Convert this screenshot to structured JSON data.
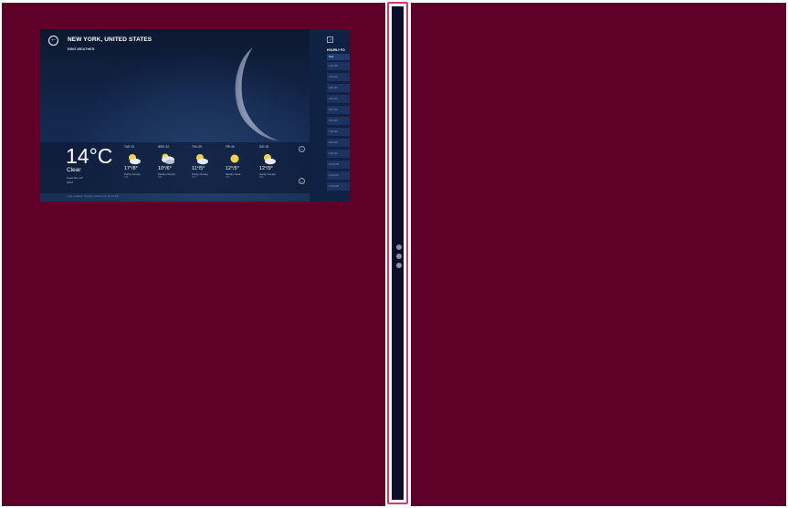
{
  "weather": {
    "back_icon": "back-arrow-icon",
    "location": "NEW YORK, UNITED STATES",
    "app_name": "BING WEATHER",
    "current": {
      "temp": "14°C",
      "condition": "Clear",
      "detail1": "Feels like 14°",
      "detail2": "MIST"
    },
    "forecast": [
      {
        "day": "TUE 23",
        "temp": "17°/8°",
        "cond": "Partly Cloudy",
        "precip": "0 %",
        "icon": "partly-cloudy-icon"
      },
      {
        "day": "WED 24",
        "temp": "10°/6°",
        "cond": "Mostly Cloudy",
        "precip": "0 %",
        "icon": "mostly-cloudy-icon"
      },
      {
        "day": "THU 25",
        "temp": "11°/5°",
        "cond": "Partly Cloudy",
        "precip": "0 %",
        "icon": "partly-cloudy-icon"
      },
      {
        "day": "FRI 26",
        "temp": "12°/5°",
        "cond": "Mostly Clear",
        "precip": "0 %",
        "icon": "sunny-icon"
      },
      {
        "day": "SAT 26",
        "temp": "12°/9°",
        "cond": "Partly Cloudy",
        "precip": "0 %",
        "icon": "partly-cloudy-icon"
      }
    ],
    "footer": "Last updated: Sunday, October 21, 12:51 PM",
    "hourly": {
      "title": "HOURLY FO",
      "now_label": "Now",
      "rows": [
        "1:00 AM",
        "2:00 AM",
        "3:00 AM",
        "4:00 AM",
        "5:00 AM",
        "6:00 AM",
        "7:00 AM",
        "8:00 AM",
        "9:00 AM",
        "10:00 AM",
        "11:00 AM",
        "12:00 PM"
      ]
    }
  },
  "colors": {
    "background": "#5f0028",
    "divider_border": "#d23a6d",
    "divider_bar": "#0d0f2a"
  }
}
